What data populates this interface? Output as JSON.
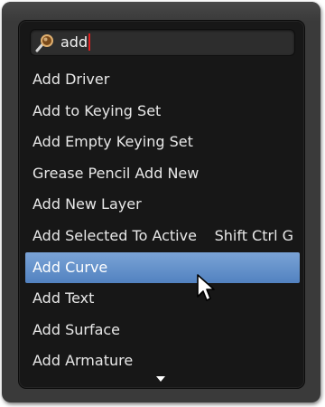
{
  "search": {
    "value": "add",
    "icon": "search-icon"
  },
  "menu": {
    "items": [
      {
        "label": "Add Driver",
        "shortcut": ""
      },
      {
        "label": "Add to Keying Set",
        "shortcut": ""
      },
      {
        "label": "Add Empty Keying Set",
        "shortcut": ""
      },
      {
        "label": "Grease Pencil Add New",
        "shortcut": ""
      },
      {
        "label": "Add New Layer",
        "shortcut": ""
      },
      {
        "label": "Add Selected To Active",
        "shortcut": "Shift Ctrl G"
      },
      {
        "label": "Add Curve",
        "shortcut": ""
      },
      {
        "label": "Add Text",
        "shortcut": ""
      },
      {
        "label": "Add Surface",
        "shortcut": ""
      },
      {
        "label": "Add Armature",
        "shortcut": ""
      }
    ],
    "selected_index": 6,
    "more_indicator": "chevron-down-icon"
  },
  "colors": {
    "window_bg": "#3a3a3a",
    "popup_bg": "#171717",
    "selection": "#6793cc",
    "text": "#e8e8e8",
    "caret": "#e02020"
  }
}
